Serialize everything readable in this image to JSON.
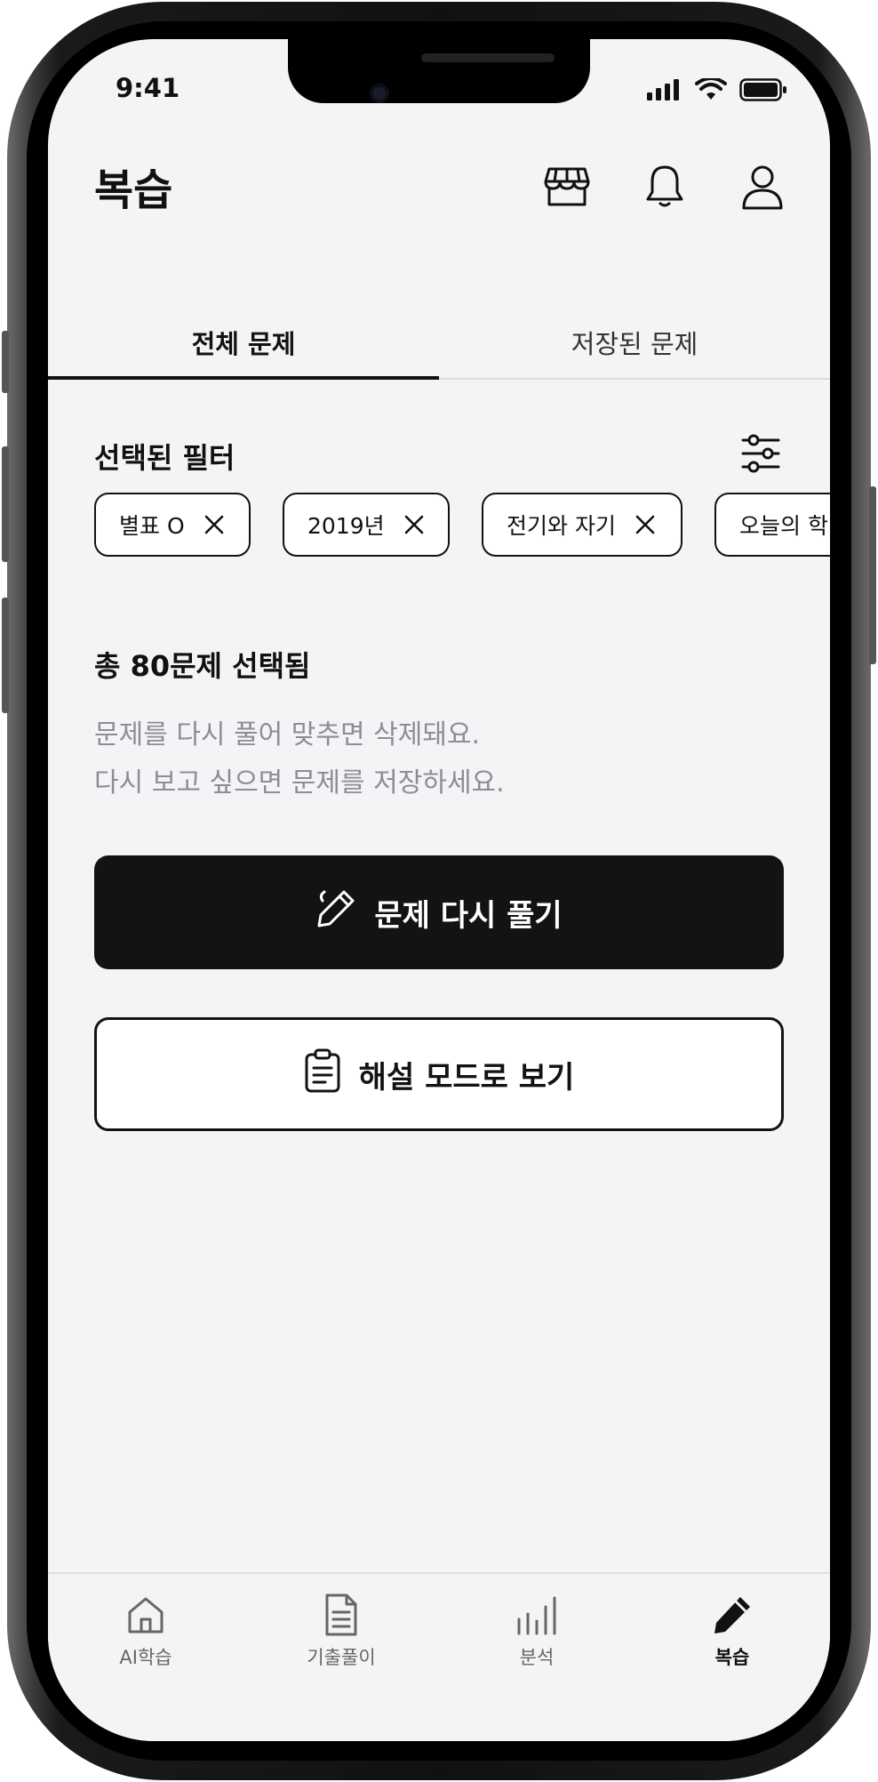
{
  "status_bar": {
    "time": "9:41"
  },
  "header": {
    "title": "복습",
    "icons": [
      "store-icon",
      "bell-icon",
      "user-icon"
    ]
  },
  "tabs": [
    {
      "label": "전체 문제",
      "active": true
    },
    {
      "label": "저장된 문제",
      "active": false
    }
  ],
  "filters": {
    "title": "선택된 필터",
    "chips": [
      {
        "label": "별표 O"
      },
      {
        "label": "2019년"
      },
      {
        "label": "전기와 자기"
      },
      {
        "label": "오늘의 학"
      }
    ]
  },
  "summary": {
    "count_text": "총 80문제 선택됨",
    "desc_line1": "문제를 다시 풀어 맞추면 삭제돼요.",
    "desc_line2": "다시 보고 싶으면 문제를 저장하세요."
  },
  "actions": {
    "retry_label": "문제 다시 풀기",
    "explain_label": "해설 모드로 보기"
  },
  "bottom_nav": [
    {
      "label": "AI학습",
      "icon": "home-icon",
      "active": false
    },
    {
      "label": "기출풀이",
      "icon": "document-icon",
      "active": false
    },
    {
      "label": "분석",
      "icon": "bar-chart-icon",
      "active": false
    },
    {
      "label": "복습",
      "icon": "pencil-icon",
      "active": true
    }
  ],
  "colors": {
    "background": "#f5f3f6",
    "primary": "#141214",
    "muted_text": "#8f8d92"
  }
}
